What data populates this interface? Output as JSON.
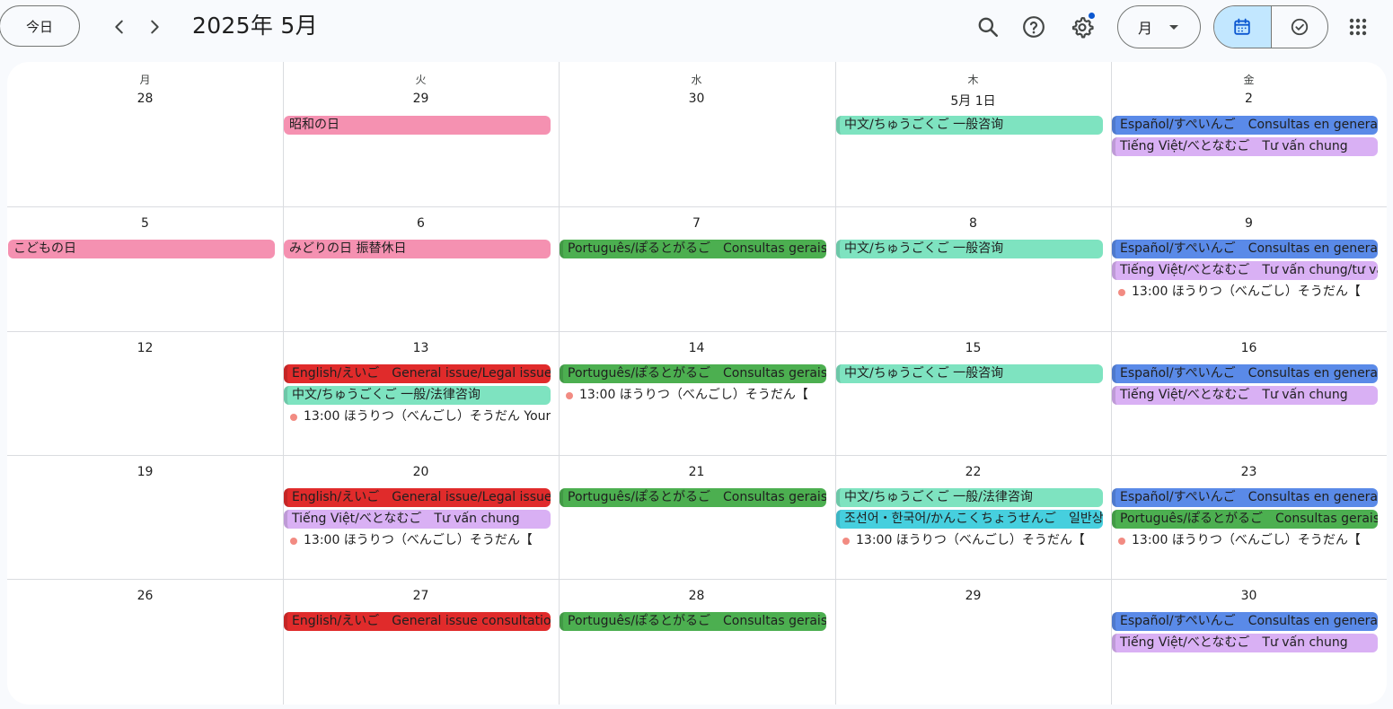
{
  "toolbar": {
    "today_label": "今日",
    "title": "2025年 5月",
    "view_label": "月",
    "icons": [
      "search-icon",
      "help-icon",
      "settings-icon",
      "calendar-icon",
      "task-icon",
      "apps-icon"
    ]
  },
  "colors": {
    "holiday": "#f591b1",
    "chinese": "#7ee3c0",
    "spanish": "#5a8ae8",
    "vietnamese": "#d9b0f4",
    "portuguese": "#4caf50",
    "english": "#e02b2b",
    "korean": "#46cfde",
    "dot": "#f28b82",
    "selected_view": "#c2e7ff"
  },
  "weekdays": [
    "月",
    "火",
    "水",
    "木",
    "金"
  ],
  "weeks": [
    {
      "days": [
        "28",
        "29",
        "30",
        "5月 1日",
        "2"
      ]
    },
    {
      "days": [
        "5",
        "6",
        "7",
        "8",
        "9"
      ]
    },
    {
      "days": [
        "12",
        "13",
        "14",
        "15",
        "16"
      ]
    },
    {
      "days": [
        "19",
        "20",
        "21",
        "22",
        "23"
      ]
    },
    {
      "days": [
        "26",
        "27",
        "28",
        "29",
        "30"
      ]
    }
  ],
  "events": [
    {
      "week": 0,
      "day": 1,
      "slot": 0,
      "kind": "holiday",
      "text": "昭和の日"
    },
    {
      "week": 0,
      "day": 3,
      "slot": 0,
      "kind": "chinese",
      "text": "中文/ちゅうごくご 一般咨询"
    },
    {
      "week": 0,
      "day": 4,
      "slot": 0,
      "kind": "spanish",
      "text": "Español/すぺいんご　Consultas en generales"
    },
    {
      "week": 0,
      "day": 4,
      "slot": 1,
      "kind": "vietnamese",
      "text": "Tiếng Việt/べとなむご　Tư vấn chung"
    },
    {
      "week": 1,
      "day": 0,
      "slot": 0,
      "kind": "holiday",
      "text": "こどもの日"
    },
    {
      "week": 1,
      "day": 1,
      "slot": 0,
      "kind": "holiday",
      "text": "みどりの日 振替休日"
    },
    {
      "week": 1,
      "day": 2,
      "slot": 0,
      "kind": "portuguese",
      "text": "Português/ぽるとがるご　Consultas gerais"
    },
    {
      "week": 1,
      "day": 3,
      "slot": 0,
      "kind": "chinese",
      "text": "中文/ちゅうごくご 一般咨询"
    },
    {
      "week": 1,
      "day": 4,
      "slot": 0,
      "kind": "spanish",
      "text": "Español/すぺいんご　Consultas en generales"
    },
    {
      "week": 1,
      "day": 4,
      "slot": 1,
      "kind": "vietnamese",
      "text": "Tiếng Việt/べとなむご　Tư vấn chung/tư vấn pháp luật"
    },
    {
      "week": 1,
      "day": 4,
      "slot": 2,
      "kind": "dot",
      "text": "13:00 ほうりつ（べんごし）そうだん【"
    },
    {
      "week": 2,
      "day": 1,
      "slot": 0,
      "kind": "english",
      "text": "English/えいご　General issue/Legal issue consultation"
    },
    {
      "week": 2,
      "day": 1,
      "slot": 1,
      "kind": "chinese",
      "text": "中文/ちゅうごくご 一般/法律咨询"
    },
    {
      "week": 2,
      "day": 1,
      "slot": 2,
      "kind": "dot",
      "text": "13:00 ほうりつ（べんごし）そうだん Your"
    },
    {
      "week": 2,
      "day": 2,
      "slot": 0,
      "kind": "portuguese",
      "text": "Português/ぽるとがるご　Consultas gerais"
    },
    {
      "week": 2,
      "day": 2,
      "slot": 1,
      "kind": "dot",
      "text": "13:00 ほうりつ（べんごし）そうだん【"
    },
    {
      "week": 2,
      "day": 3,
      "slot": 0,
      "kind": "chinese",
      "text": "中文/ちゅうごくご 一般咨询"
    },
    {
      "week": 2,
      "day": 4,
      "slot": 0,
      "kind": "spanish",
      "text": "Español/すぺいんご　Consultas en generales"
    },
    {
      "week": 2,
      "day": 4,
      "slot": 1,
      "kind": "vietnamese",
      "text": "Tiếng Việt/べとなむご　Tư vấn chung"
    },
    {
      "week": 3,
      "day": 1,
      "slot": 0,
      "kind": "english",
      "text": "English/えいご　General issue/Legal issue consultation"
    },
    {
      "week": 3,
      "day": 1,
      "slot": 1,
      "kind": "vietnamese",
      "text": "Tiếng Việt/べとなむご　Tư vấn chung"
    },
    {
      "week": 3,
      "day": 1,
      "slot": 2,
      "kind": "dot",
      "text": "13:00 ほうりつ（べんごし）そうだん【"
    },
    {
      "week": 3,
      "day": 2,
      "slot": 0,
      "kind": "portuguese",
      "text": "Português/ぽるとがるご　Consultas gerais"
    },
    {
      "week": 3,
      "day": 3,
      "slot": 0,
      "kind": "chinese",
      "text": "中文/ちゅうごくご 一般/法律咨询"
    },
    {
      "week": 3,
      "day": 3,
      "slot": 1,
      "kind": "korean",
      "text": "조선어・한국어/かんこくちょうせんご　일반상담"
    },
    {
      "week": 3,
      "day": 3,
      "slot": 2,
      "kind": "dot",
      "text": "13:00 ほうりつ（べんごし）そうだん【"
    },
    {
      "week": 3,
      "day": 4,
      "slot": 0,
      "kind": "spanish",
      "text": "Español/すぺいんご　Consultas en generales"
    },
    {
      "week": 3,
      "day": 4,
      "slot": 1,
      "kind": "portuguese",
      "text": "Português/ぽるとがるご　Consultas gerais"
    },
    {
      "week": 3,
      "day": 4,
      "slot": 2,
      "kind": "dot",
      "text": "13:00 ほうりつ（べんごし）そうだん【"
    },
    {
      "week": 4,
      "day": 1,
      "slot": 0,
      "kind": "english",
      "text": "English/えいご　General issue consultation"
    },
    {
      "week": 4,
      "day": 2,
      "slot": 0,
      "kind": "portuguese",
      "text": "Português/ぽるとがるご　Consultas gerais"
    },
    {
      "week": 4,
      "day": 4,
      "slot": 0,
      "kind": "spanish",
      "text": "Español/すぺいんご　Consultas en generales"
    },
    {
      "week": 4,
      "day": 4,
      "slot": 1,
      "kind": "vietnamese",
      "text": "Tiếng Việt/べとなむご　Tư vấn chung"
    }
  ]
}
